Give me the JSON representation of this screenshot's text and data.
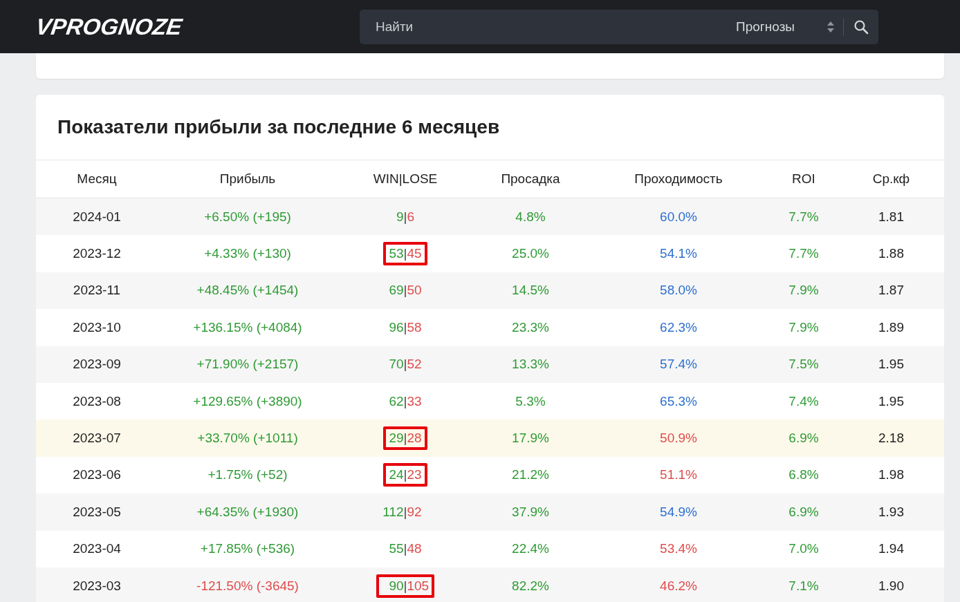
{
  "header": {
    "logo": "VPROGNOZE",
    "search": {
      "placeholder": "Найти",
      "category": "Прогнозы"
    }
  },
  "profit_table": {
    "title": "Показатели прибыли за последние 6 месяцев",
    "columns": [
      "Месяц",
      "Прибыль",
      "WIN|LOSE",
      "Просадка",
      "Проходимость",
      "ROI",
      "Ср.кф"
    ],
    "rows": [
      {
        "month": "2024-01",
        "profit": "+6.50% (+195)",
        "profit_negative": false,
        "win": "9",
        "separator": "|",
        "lose": "6",
        "highlighted": false,
        "selected": false,
        "drawdown": "4.8%",
        "pass_rate": "60.0%",
        "pass_rate_low": false,
        "roi": "7.7%",
        "avg_odds": "1.81"
      },
      {
        "month": "2023-12",
        "profit": "+4.33% (+130)",
        "profit_negative": false,
        "win": "53",
        "separator": "|",
        "lose": "45",
        "highlighted": true,
        "selected": false,
        "drawdown": "25.0%",
        "pass_rate": "54.1%",
        "pass_rate_low": false,
        "roi": "7.7%",
        "avg_odds": "1.88"
      },
      {
        "month": "2023-11",
        "profit": "+48.45% (+1454)",
        "profit_negative": false,
        "win": "69",
        "separator": "|",
        "lose": "50",
        "highlighted": false,
        "selected": false,
        "drawdown": "14.5%",
        "pass_rate": "58.0%",
        "pass_rate_low": false,
        "roi": "7.9%",
        "avg_odds": "1.87"
      },
      {
        "month": "2023-10",
        "profit": "+136.15% (+4084)",
        "profit_negative": false,
        "win": "96",
        "separator": "|",
        "lose": "58",
        "highlighted": false,
        "selected": false,
        "drawdown": "23.3%",
        "pass_rate": "62.3%",
        "pass_rate_low": false,
        "roi": "7.9%",
        "avg_odds": "1.89"
      },
      {
        "month": "2023-09",
        "profit": "+71.90% (+2157)",
        "profit_negative": false,
        "win": "70",
        "separator": "|",
        "lose": "52",
        "highlighted": false,
        "selected": false,
        "drawdown": "13.3%",
        "pass_rate": "57.4%",
        "pass_rate_low": false,
        "roi": "7.5%",
        "avg_odds": "1.95"
      },
      {
        "month": "2023-08",
        "profit": "+129.65% (+3890)",
        "profit_negative": false,
        "win": "62",
        "separator": "|",
        "lose": "33",
        "highlighted": false,
        "selected": false,
        "drawdown": "5.3%",
        "pass_rate": "65.3%",
        "pass_rate_low": false,
        "roi": "7.4%",
        "avg_odds": "1.95"
      },
      {
        "month": "2023-07",
        "profit": "+33.70% (+1011)",
        "profit_negative": false,
        "win": "29",
        "separator": "|",
        "lose": "28",
        "highlighted": true,
        "selected": true,
        "drawdown": "17.9%",
        "pass_rate": "50.9%",
        "pass_rate_low": true,
        "roi": "6.9%",
        "avg_odds": "2.18"
      },
      {
        "month": "2023-06",
        "profit": "+1.75% (+52)",
        "profit_negative": false,
        "win": "24",
        "separator": "|",
        "lose": "23",
        "highlighted": true,
        "selected": false,
        "drawdown": "21.2%",
        "pass_rate": "51.1%",
        "pass_rate_low": true,
        "roi": "6.8%",
        "avg_odds": "1.98"
      },
      {
        "month": "2023-05",
        "profit": "+64.35% (+1930)",
        "profit_negative": false,
        "win": "112",
        "separator": "|",
        "lose": "92",
        "highlighted": false,
        "selected": false,
        "drawdown": "37.9%",
        "pass_rate": "54.9%",
        "pass_rate_low": false,
        "roi": "6.9%",
        "avg_odds": "1.93"
      },
      {
        "month": "2023-04",
        "profit": "+17.85% (+536)",
        "profit_negative": false,
        "win": "55",
        "separator": "|",
        "lose": "48",
        "highlighted": false,
        "selected": false,
        "drawdown": "22.4%",
        "pass_rate": "53.4%",
        "pass_rate_low": true,
        "roi": "7.0%",
        "avg_odds": "1.94"
      },
      {
        "month": "2023-03",
        "profit": "-121.50% (-3645)",
        "profit_negative": true,
        "win": "90",
        "separator": "|",
        "lose": "105",
        "highlighted": true,
        "selected": false,
        "drawdown": "82.2%",
        "pass_rate": "46.2%",
        "pass_rate_low": true,
        "roi": "7.1%",
        "avg_odds": "1.90"
      }
    ]
  }
}
